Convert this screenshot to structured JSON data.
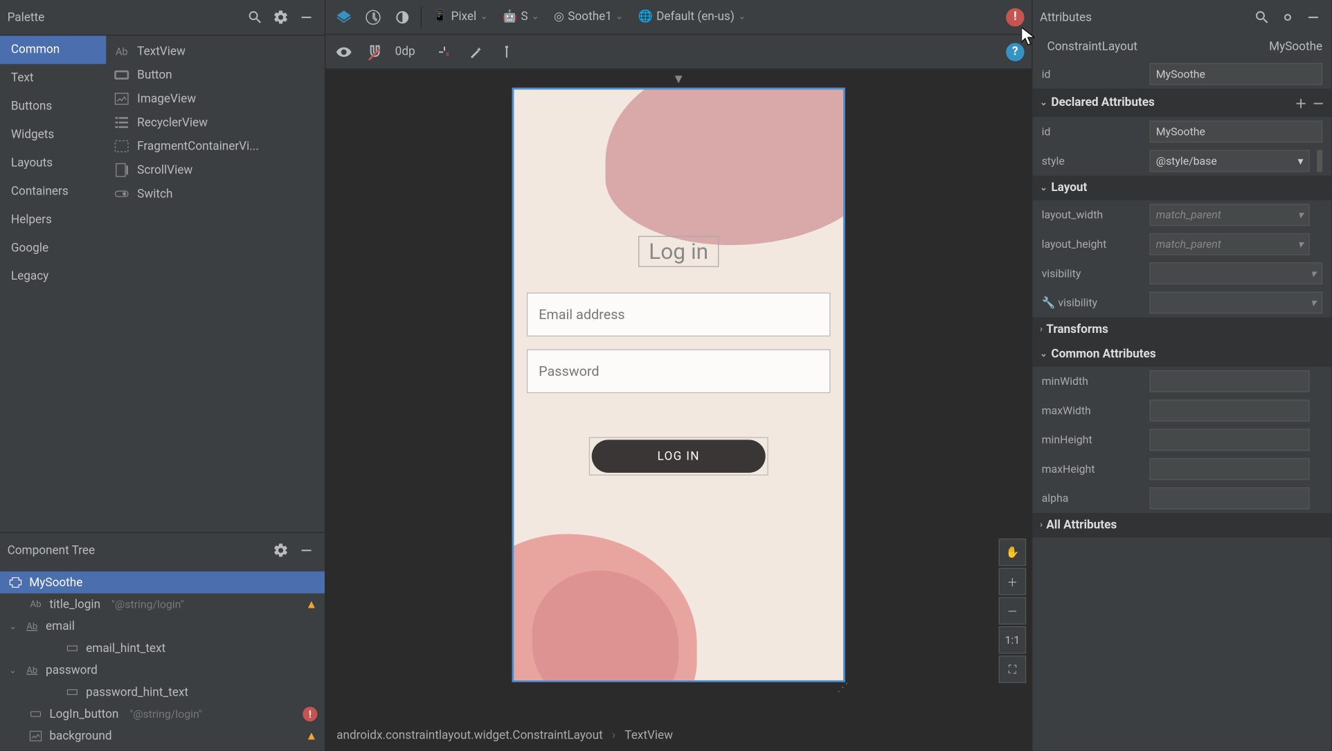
{
  "palette": {
    "title": "Palette",
    "categories": [
      "Common",
      "Text",
      "Buttons",
      "Widgets",
      "Layouts",
      "Containers",
      "Helpers",
      "Google",
      "Legacy"
    ],
    "items": [
      {
        "icon": "ab",
        "label": "TextView"
      },
      {
        "icon": "rect",
        "label": "Button"
      },
      {
        "icon": "image",
        "label": "ImageView"
      },
      {
        "icon": "list",
        "label": "RecyclerView"
      },
      {
        "icon": "frag",
        "label": "FragmentContainerVi..."
      },
      {
        "icon": "scroll",
        "label": "ScrollView"
      },
      {
        "icon": "switch",
        "label": "Switch"
      }
    ]
  },
  "device_toolbar": {
    "device": "Pixel",
    "api": "S",
    "theme": "Soothe1",
    "locale": "Default (en-us)"
  },
  "center_tools": {
    "zoom": "0dp"
  },
  "component_tree": {
    "title": "Component Tree",
    "root": "MySoothe",
    "nodes": [
      {
        "depth": 1,
        "icon": "ab",
        "label": "title_login",
        "hint": "\"@string/login\"",
        "badge": "warn"
      },
      {
        "depth": 1,
        "icon": "ab",
        "label": "email",
        "expandable": true
      },
      {
        "depth": 2,
        "icon": "rect",
        "label": "email_hint_text"
      },
      {
        "depth": 1,
        "icon": "ab",
        "label": "password",
        "expandable": true
      },
      {
        "depth": 2,
        "icon": "rect",
        "label": "password_hint_text"
      },
      {
        "depth": 1,
        "icon": "rect",
        "label": "LogIn_button",
        "hint": "\"@string/login\"",
        "badge": "error"
      },
      {
        "depth": 1,
        "icon": "image",
        "label": "background",
        "badge": "warn"
      }
    ]
  },
  "preview": {
    "title": "Log in",
    "email_hint": "Email address",
    "password_hint": "Password",
    "button": "LOG IN"
  },
  "attributes": {
    "title": "Attributes",
    "type": "ConstraintLayout",
    "instance": "MySoothe",
    "id": {
      "label": "id",
      "value": "MySoothe"
    },
    "declared_title": "Declared Attributes",
    "declared": [
      {
        "label": "id",
        "value": "MySoothe"
      },
      {
        "label": "style",
        "value": "@style/base",
        "dropdown": true
      }
    ],
    "layout_title": "Layout",
    "layout": [
      {
        "label": "layout_width",
        "value": "match_parent",
        "dropdown": true,
        "italic": true
      },
      {
        "label": "layout_height",
        "value": "match_parent",
        "dropdown": true,
        "italic": true
      },
      {
        "label": "visibility",
        "value": "",
        "dropdown": true
      },
      {
        "label": "visibility",
        "value": "",
        "dropdown": true,
        "tools": true
      }
    ],
    "transforms_title": "Transforms",
    "common_title": "Common Attributes",
    "common": [
      {
        "label": "minWidth"
      },
      {
        "label": "maxWidth"
      },
      {
        "label": "minHeight"
      },
      {
        "label": "maxHeight"
      },
      {
        "label": "alpha"
      }
    ],
    "all_title": "All Attributes"
  },
  "canvas_tools": {
    "ratio": "1:1"
  },
  "breadcrumb": {
    "a": "androidx.constraintlayout.widget.ConstraintLayout",
    "b": "TextView"
  }
}
